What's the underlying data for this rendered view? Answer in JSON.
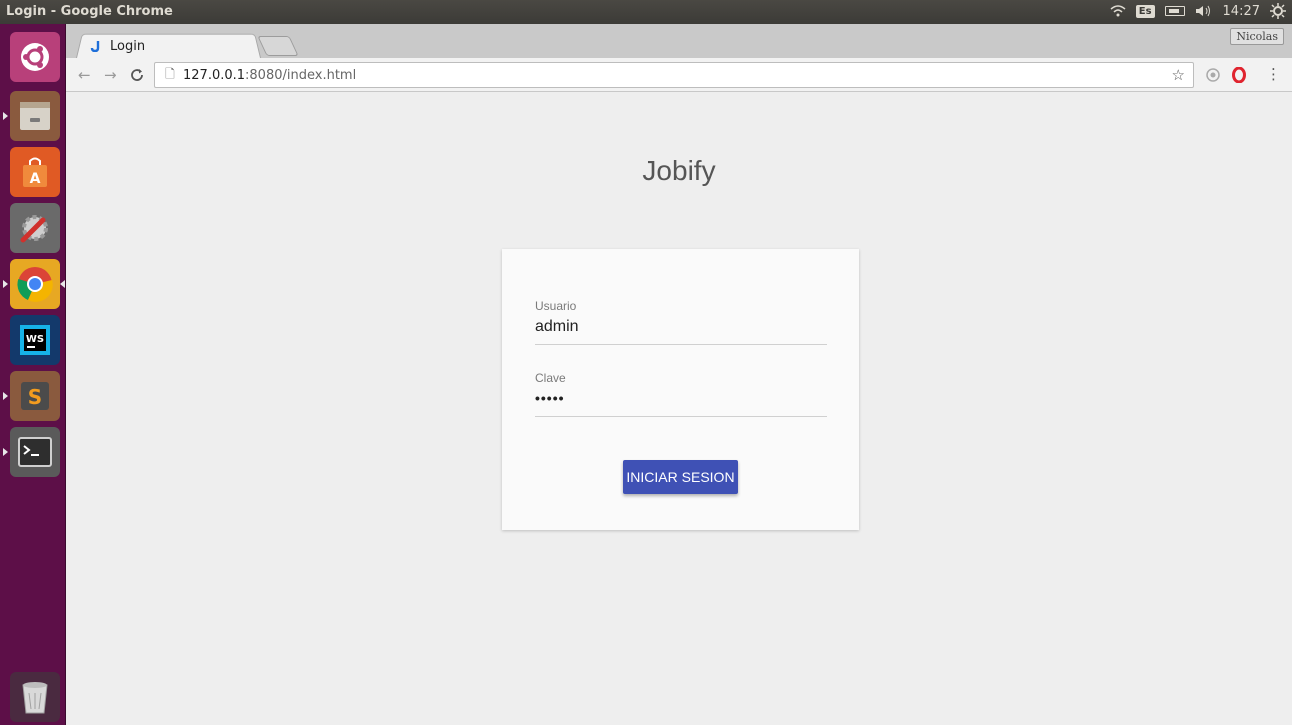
{
  "os_panel": {
    "window_title": "Login - Google Chrome",
    "keyboard_layout": "Es",
    "clock": "14:27",
    "icons": [
      "wifi-icon",
      "battery-icon",
      "volume-icon",
      "settings-gear-icon"
    ]
  },
  "launcher": {
    "items": [
      {
        "name": "ubuntu-dash",
        "icon": "ubuntu-logo-icon",
        "color": "#c84a85"
      },
      {
        "name": "files",
        "icon": "file-cabinet-icon",
        "color": "#c49a6c"
      },
      {
        "name": "software-center",
        "icon": "shopping-bag-icon",
        "color": "#e05a24"
      },
      {
        "name": "system-settings",
        "icon": "wrench-gear-icon",
        "color": "#7a7a7a"
      },
      {
        "name": "chrome",
        "icon": "chrome-icon",
        "color": "#f2b01e"
      },
      {
        "name": "webstorm",
        "icon": "webstorm-icon",
        "color": "#1e6fd9"
      },
      {
        "name": "sublime-text",
        "icon": "sublime-icon",
        "color": "#e88a1a"
      },
      {
        "name": "terminal",
        "icon": "terminal-icon",
        "color": "#3a3a3a"
      },
      {
        "name": "trash",
        "icon": "trash-icon",
        "color": "#cfcfcf"
      }
    ]
  },
  "browser": {
    "tab": {
      "title": "Login",
      "close": "×"
    },
    "profile_name": "Nicolas",
    "address": {
      "host": "127.0.0.1",
      "rest": ":8080/index.html"
    }
  },
  "page": {
    "title": "Jobify",
    "username": {
      "label": "Usuario",
      "value": "admin"
    },
    "password": {
      "label": "Clave",
      "value": "•••••"
    },
    "submit_label": "INICIAR SESION",
    "accent": "#3f51b5"
  }
}
